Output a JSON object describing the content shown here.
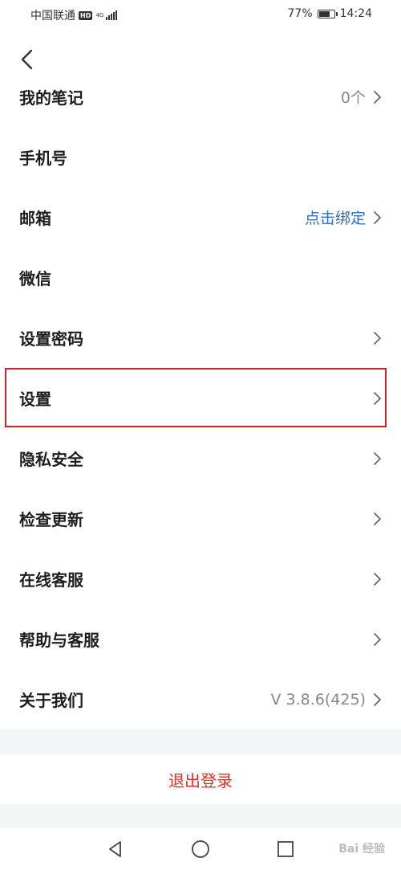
{
  "status_bar": {
    "carrier": "中国联通",
    "hd": "HD",
    "network": "4G",
    "battery_percent": "77%",
    "battery_level": 0.77,
    "time": "14:24"
  },
  "menu": {
    "items": [
      {
        "label": "我的笔记",
        "value": "0个",
        "value_style": "plain",
        "chevron": true
      },
      {
        "label": "手机号",
        "value": "",
        "value_style": "plain",
        "chevron": false
      },
      {
        "label": "邮箱",
        "value": "点击绑定",
        "value_style": "link",
        "chevron": true
      },
      {
        "label": "微信",
        "value": "",
        "value_style": "plain",
        "chevron": false
      },
      {
        "label": "设置密码",
        "value": "",
        "value_style": "plain",
        "chevron": true
      },
      {
        "label": "设置",
        "value": "",
        "value_style": "plain",
        "chevron": true,
        "highlighted": true
      },
      {
        "label": "隐私安全",
        "value": "",
        "value_style": "plain",
        "chevron": true
      },
      {
        "label": "检查更新",
        "value": "",
        "value_style": "plain",
        "chevron": true
      },
      {
        "label": "在线客服",
        "value": "",
        "value_style": "plain",
        "chevron": true
      },
      {
        "label": "帮助与客服",
        "value": "",
        "value_style": "plain",
        "chevron": true
      },
      {
        "label": "关于我们",
        "value": "V 3.8.6(425)",
        "value_style": "plain",
        "chevron": true
      }
    ]
  },
  "logout": {
    "label": "退出登录"
  },
  "colors": {
    "link": "#2a6ed4",
    "danger": "#d8322d",
    "highlight_border": "#d0202a",
    "separator_band": "#f4f5f7"
  },
  "icons": {
    "back": "chevron-left-icon",
    "row_chevron": "chevron-right-icon",
    "nav_back": "triangle-back-icon",
    "nav_home": "circle-home-icon",
    "nav_recents": "square-recents-icon"
  },
  "watermark": "Bai 经验"
}
